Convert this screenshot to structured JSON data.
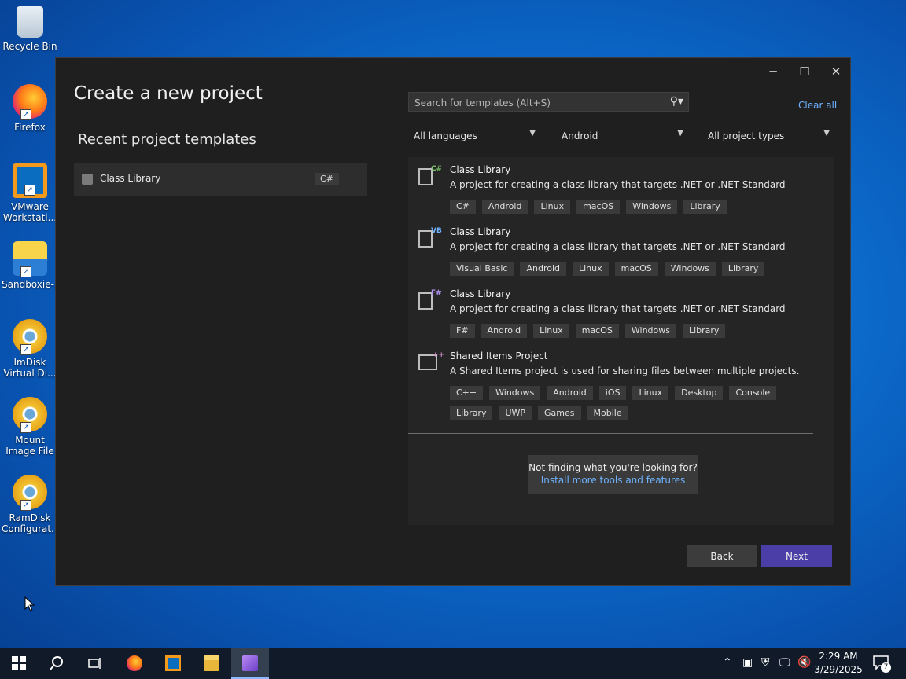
{
  "desktop": {
    "icons": [
      {
        "label": "Recycle Bin",
        "name": "recycle-bin-icon"
      },
      {
        "label": "Firefox",
        "name": "firefox-icon"
      },
      {
        "label": "VMware Workstati...",
        "name": "vmware-icon"
      },
      {
        "label": "Sandboxie-...",
        "name": "sandboxie-icon"
      },
      {
        "label": "ImDisk Virtual Di...",
        "name": "imdisk-icon"
      },
      {
        "label": "Mount Image File",
        "name": "mount-image-icon"
      },
      {
        "label": "RamDisk Configurat...",
        "name": "ramdisk-icon"
      }
    ]
  },
  "window": {
    "title": "Create a new project",
    "controls": {
      "minimize": "─",
      "maximize": "☐",
      "close": "✕"
    },
    "recent": {
      "heading": "Recent project templates",
      "items": [
        {
          "label": "Class Library",
          "tag": "C#"
        }
      ]
    },
    "search": {
      "placeholder": "Search for templates (Alt+S)",
      "value": ""
    },
    "clear_all": "Clear all",
    "filters": {
      "language": "All languages",
      "platform": "Android",
      "project_type": "All project types"
    },
    "templates": [
      {
        "name": "Class Library",
        "description": "A project for creating a class library that targets .NET or .NET Standard",
        "lang": "C#",
        "lang_color": "#7ec86c",
        "tags": [
          "C#",
          "Android",
          "Linux",
          "macOS",
          "Windows",
          "Library"
        ]
      },
      {
        "name": "Class Library",
        "description": "A project for creating a class library that targets .NET or .NET Standard",
        "lang": "VB",
        "lang_color": "#6fb3ff",
        "tags": [
          "Visual Basic",
          "Android",
          "Linux",
          "macOS",
          "Windows",
          "Library"
        ]
      },
      {
        "name": "Class Library",
        "description": "A project for creating a class library that targets .NET or .NET Standard",
        "lang": "F#",
        "lang_color": "#b392f0",
        "tags": [
          "F#",
          "Android",
          "Linux",
          "macOS",
          "Windows",
          "Library"
        ]
      },
      {
        "name": "Shared Items Project",
        "description": "A Shared Items project is used for sharing files between multiple projects.",
        "lang": "++",
        "lang_color": "#c586c0",
        "tags": [
          "C++",
          "Windows",
          "Android",
          "iOS",
          "Linux",
          "Desktop",
          "Console",
          "Library",
          "UWP",
          "Games",
          "Mobile"
        ]
      }
    ],
    "help": {
      "text": "Not finding what you're looking for?",
      "link": "Install more tools and features"
    },
    "buttons": {
      "back": "Back",
      "next": "Next"
    }
  },
  "taskbar": {
    "clock_time": "2:29 AM",
    "clock_date": "3/29/2025",
    "notification_count": "7"
  }
}
